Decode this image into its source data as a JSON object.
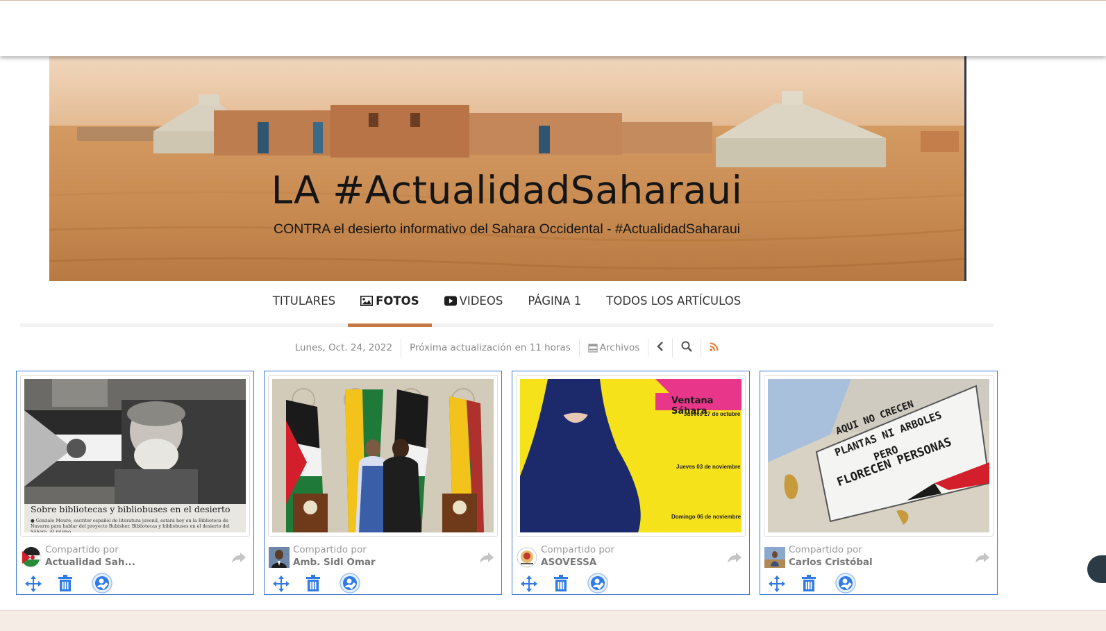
{
  "banner": {
    "title": "LA #ActualidadSaharaui",
    "subtitle": "CONTRA el desierto informativo del Sahara Occidental - #ActualidadSaharaui"
  },
  "nav": {
    "items": [
      {
        "label": "TITULARES",
        "icon": "",
        "active": false
      },
      {
        "label": "FOTOS",
        "icon": "image-icon",
        "active": true
      },
      {
        "label": "VIDEOS",
        "icon": "youtube-play-icon",
        "active": false
      },
      {
        "label": "PÁGINA 1",
        "icon": "",
        "active": false
      },
      {
        "label": "TODOS LOS ARTÍCULOS",
        "icon": "",
        "active": false
      }
    ]
  },
  "infobar": {
    "date": "Lunes, Oct. 24, 2022",
    "next_update": "Próxima actualización en 11 horas",
    "archives": "Archivos",
    "rss_color": "#e8731f"
  },
  "cards": [
    {
      "shared_by_label": "Compartido por",
      "shared_by_name": "Actualidad Sah...",
      "image_caption": "Sobre bibliotecas y bibliobuses en el desierto",
      "image_text": "● Gonzalo Moure, escritor español de literatura juvenil, estará hoy en la Biblioteca de Navarra para hablar del proyecto Bubisher. Bibliotecas y bibliobuses en el desierto del Sáhara. Al mismo"
    },
    {
      "shared_by_label": "Compartido por",
      "shared_by_name": "Amb. Sidi Omar"
    },
    {
      "shared_by_label": "Compartido por",
      "shared_by_name": "ASOVESSA",
      "poster": {
        "heading": "Ventana Sáhara",
        "date1": "Jueves 27 de octubre",
        "date2": "Jueves 03 de noviembre",
        "date3": "Domingo 06 de noviembre"
      }
    },
    {
      "shared_by_label": "Compartido por",
      "shared_by_name": "Carlos Cristóbal",
      "sign_lines": [
        "AQUI NO CRECEN",
        "PLANTAS NI ARBOLES",
        "PERO",
        "FLORECEN PERSONAS"
      ]
    }
  ],
  "colors": {
    "accent": "#c57944",
    "card_border": "#3d78d8",
    "action_blue": "#2f7ae5"
  }
}
